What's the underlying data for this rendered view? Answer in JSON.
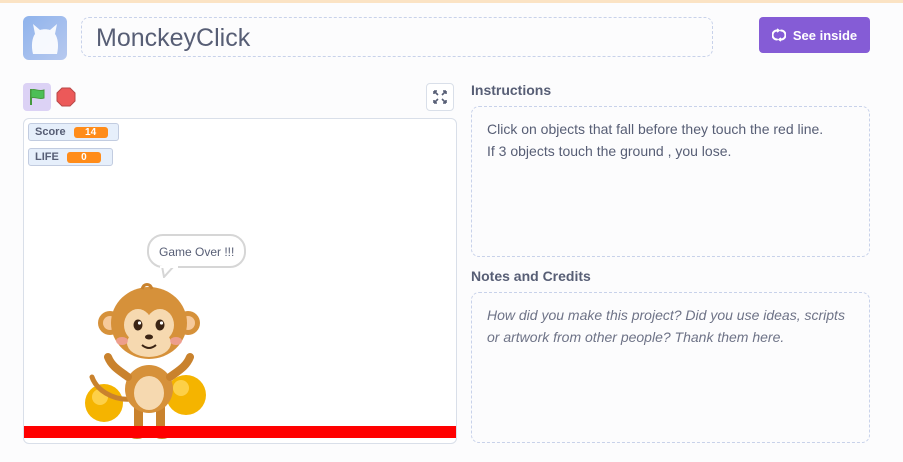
{
  "project": {
    "title": "MonckeyClick",
    "see_inside_label": "See inside"
  },
  "stage": {
    "monitors": [
      {
        "label": "Score",
        "value": "14"
      },
      {
        "label": "LIFE",
        "value": "0"
      }
    ],
    "speech_bubble": "Game Over !!!",
    "ground_color": "#ff0000"
  },
  "instructions": {
    "heading": "Instructions",
    "lines": [
      "Click on objects that fall before they touch the red line.",
      "If 3 objects touch the ground , you lose."
    ]
  },
  "notes": {
    "heading": "Notes and Credits",
    "placeholder_lines": [
      "How did you make this project? Did you use ideas, scripts",
      "or artwork from other people? Thank them here."
    ]
  },
  "colors": {
    "accent": "#855cd6",
    "monitor_value": "#ff8c1a",
    "text": "#575e75"
  },
  "icons": {
    "flag": "green-flag-icon",
    "stop": "stop-sign-icon",
    "fullscreen": "fullscreen-icon",
    "see_inside": "see-inside-icon"
  }
}
